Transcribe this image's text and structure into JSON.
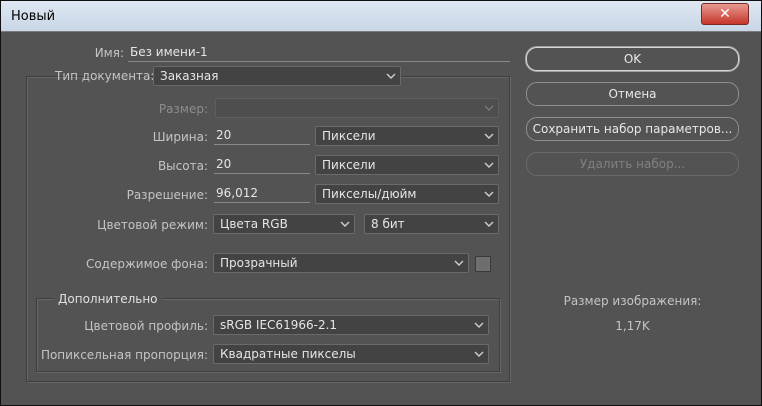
{
  "window": {
    "title": "Новый",
    "close_glyph": "✕"
  },
  "name_row": {
    "label": "Имя:",
    "value": "Без имени-1"
  },
  "document_type": {
    "label": "Тип документа:",
    "value": "Заказная"
  },
  "size": {
    "label": "Размер:",
    "value": ""
  },
  "width": {
    "label": "Ширина:",
    "value": "20",
    "unit": "Пиксели"
  },
  "height": {
    "label": "Высота:",
    "value": "20",
    "unit": "Пиксели"
  },
  "resolution": {
    "label": "Разрешение:",
    "value": "96,012",
    "unit": "Пикселы/дюйм"
  },
  "color_mode": {
    "label": "Цветовой режим:",
    "mode": "Цвета RGB",
    "depth": "8 бит"
  },
  "background": {
    "label": "Содержимое фона:",
    "value": "Прозрачный"
  },
  "advanced": {
    "title": "Дополнительно",
    "profile_label": "Цветовой профиль:",
    "profile_value": "sRGB IEC61966-2.1",
    "aspect_label": "Попиксельная пропорция:",
    "aspect_value": "Квадратные пикселы"
  },
  "buttons": {
    "ok": "OK",
    "cancel": "Отмена",
    "save_preset": "Сохранить набор параметров...",
    "delete_preset": "Удалить набор..."
  },
  "image_size": {
    "label": "Размер изображения:",
    "value": "1,17K"
  },
  "colors": {
    "dialog_bg": "#535353",
    "titlebar": "#d4e0ee",
    "close": "#c7372b"
  }
}
